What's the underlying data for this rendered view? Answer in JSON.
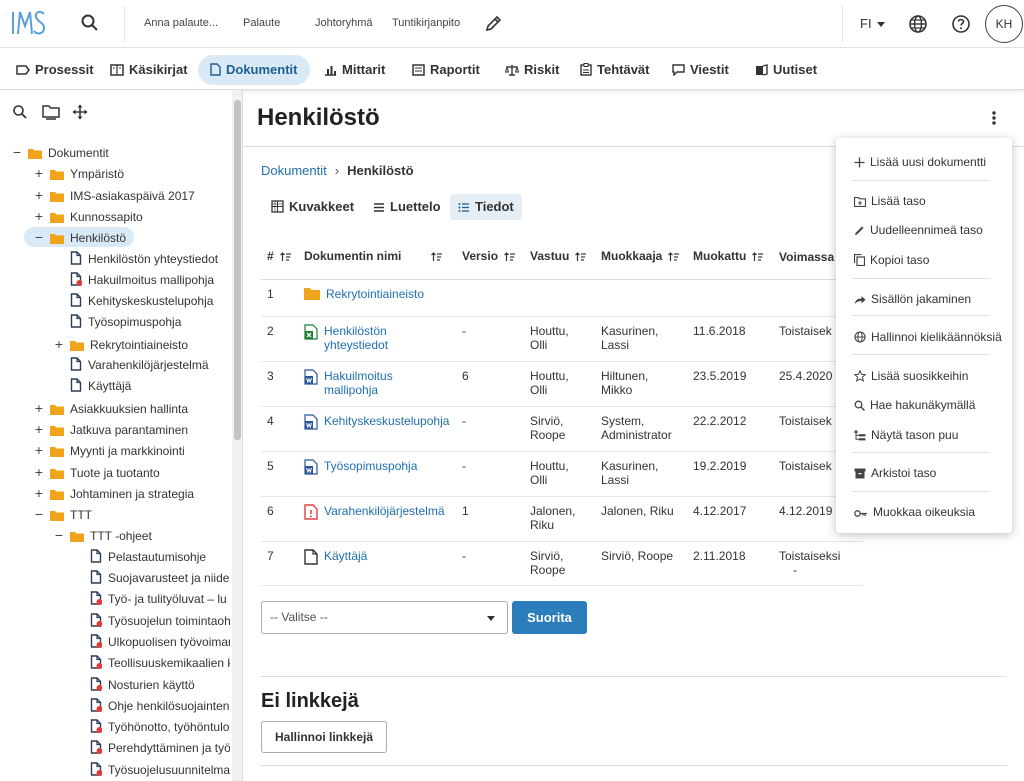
{
  "topbar": {
    "logo": "IMS",
    "quicklinks": [
      "Anna palaute...",
      "Palaute",
      "Johtoryhmä",
      "Tuntikirjanpito"
    ],
    "language": "FI",
    "avatar": "KH"
  },
  "nav": {
    "items": [
      {
        "label": "Prosessit",
        "icon": "process-icon"
      },
      {
        "label": "Käsikirjat",
        "icon": "manual-icon"
      },
      {
        "label": "Dokumentit",
        "icon": "document-icon"
      },
      {
        "label": "Mittarit",
        "icon": "chart-icon"
      },
      {
        "label": "Raportit",
        "icon": "report-icon"
      },
      {
        "label": "Riskit",
        "icon": "scale-icon"
      },
      {
        "label": "Tehtävät",
        "icon": "task-icon"
      },
      {
        "label": "Viestit",
        "icon": "message-icon"
      },
      {
        "label": "Uutiset",
        "icon": "news-icon"
      }
    ],
    "active": "Dokumentit"
  },
  "tree": [
    {
      "label": "Dokumentit",
      "toggle": "−",
      "type": "folder"
    },
    {
      "label": "Ympäristö",
      "toggle": "+",
      "type": "folder"
    },
    {
      "label": "IMS-asiakaspäivä 2017",
      "toggle": "+",
      "type": "folder"
    },
    {
      "label": "Kunnossapito",
      "toggle": "+",
      "type": "folder"
    },
    {
      "label": "Henkilöstö",
      "toggle": "−",
      "type": "folder",
      "selected": true
    },
    {
      "label": "Henkilöstön yhteystiedot",
      "toggle": "",
      "type": "doc"
    },
    {
      "label": "Hakuilmoitus mallipohja",
      "toggle": "",
      "type": "doc-alert"
    },
    {
      "label": "Kehityskeskustelupohja",
      "toggle": "",
      "type": "doc"
    },
    {
      "label": "Työsopimuspohja",
      "toggle": "",
      "type": "doc"
    },
    {
      "label": "Rekrytointiaineisto",
      "toggle": "+",
      "type": "folder"
    },
    {
      "label": "Varahenkilöjärjestelmä",
      "toggle": "",
      "type": "doc"
    },
    {
      "label": "Käyttäjä",
      "toggle": "",
      "type": "doc"
    },
    {
      "label": "Asiakkuuksien hallinta",
      "toggle": "+",
      "type": "folder"
    },
    {
      "label": "Jatkuva parantaminen",
      "toggle": "+",
      "type": "folder"
    },
    {
      "label": "Myynti ja markkinointi",
      "toggle": "+",
      "type": "folder"
    },
    {
      "label": "Tuote ja tuotanto",
      "toggle": "+",
      "type": "folder"
    },
    {
      "label": "Johtaminen ja strategia",
      "toggle": "+",
      "type": "folder"
    },
    {
      "label": "TTT",
      "toggle": "−",
      "type": "folder"
    },
    {
      "label": "TTT -ohjeet",
      "toggle": "−",
      "type": "folder"
    },
    {
      "label": "Pelastautumisohje",
      "toggle": "",
      "type": "doc"
    },
    {
      "label": "Suojavarusteet ja niiden",
      "toggle": "",
      "type": "doc"
    },
    {
      "label": "Työ- ja tulityöluvat – lu",
      "toggle": "",
      "type": "doc-alert"
    },
    {
      "label": "Työsuojelun toimintaoh",
      "toggle": "",
      "type": "doc-alert"
    },
    {
      "label": "Ulkopuolisen työvoiman",
      "toggle": "",
      "type": "doc-alert"
    },
    {
      "label": "Teollisuuskemikaalien k",
      "toggle": "",
      "type": "doc-alert"
    },
    {
      "label": "Nosturien käyttö",
      "toggle": "",
      "type": "doc-alert"
    },
    {
      "label": "Ohje henkilösuojainten",
      "toggle": "",
      "type": "doc-alert"
    },
    {
      "label": "Työhönotto, työhöntulo",
      "toggle": "",
      "type": "doc-alert"
    },
    {
      "label": "Perehdyttäminen ja työ",
      "toggle": "",
      "type": "doc-alert"
    },
    {
      "label": "Työsuojelusuunnitelma",
      "toggle": "",
      "type": "doc-alert"
    }
  ],
  "main": {
    "title": "Henkilöstö",
    "breadcrumb": {
      "root": "Dokumentit",
      "current": "Henkilöstö"
    },
    "views": [
      "Kuvakkeet",
      "Luettelo",
      "Tiedot"
    ],
    "active_view": "Tiedot",
    "columns": [
      "#",
      "Dokumentin nimi",
      "Versio",
      "Vastuu",
      "Muokkaaja",
      "Muokattu",
      "Voimassa"
    ],
    "rows": [
      {
        "n": "1",
        "name": "Rekrytointiaineisto",
        "ftype": "folder",
        "version": "",
        "owner": "",
        "editor": "",
        "modified": "",
        "valid": ""
      },
      {
        "n": "2",
        "name": "Henkilöstön yhteystiedot",
        "ftype": "excel",
        "version": "-",
        "owner": "Houttu, Olli",
        "editor": "Kasurinen, Lassi",
        "modified": "11.6.2018",
        "valid": "Toistaisek"
      },
      {
        "n": "3",
        "name": "Hakuilmoitus mallipohja",
        "ftype": "word",
        "version": "6",
        "owner": "Houttu, Olli",
        "editor": "Hiltunen, Mikko",
        "modified": "23.5.2019",
        "valid": "25.4.2020"
      },
      {
        "n": "4",
        "name": "Kehityskeskustelupohja",
        "ftype": "word",
        "version": "-",
        "owner": "Sirviö, Roope",
        "editor": "System, Administrator",
        "modified": "22.2.2012",
        "valid": "Toistaisek"
      },
      {
        "n": "5",
        "name": "Työsopimuspohja",
        "ftype": "word",
        "version": "-",
        "owner": "Houttu, Olli",
        "editor": "Kasurinen, Lassi",
        "modified": "19.2.2019",
        "valid": "Toistaisek"
      },
      {
        "n": "6",
        "name": "Varahenkilöjärjestelmä",
        "ftype": "pdf",
        "version": "1",
        "owner": "Jalonen, Riku",
        "editor": "Jalonen, Riku",
        "modified": "4.12.2017",
        "valid": "4.12.2019"
      },
      {
        "n": "7",
        "name": "Käyttäjä",
        "ftype": "blank",
        "version": "-",
        "owner": "Sirviö, Roope",
        "editor": "Sirviö, Roope",
        "modified": "2.11.2018",
        "valid": "Toistaiseksi"
      }
    ],
    "extra_cell": "-",
    "select_placeholder": "-- Valitse --",
    "run_button": "Suorita",
    "links_title": "Ei linkkejä",
    "links_button": "Hallinnoi linkkejä"
  },
  "menu": [
    {
      "label": "Lisää uusi dokumentti",
      "icon": "plus-icon"
    },
    {
      "label": "Lisää taso",
      "icon": "add-folder-icon"
    },
    {
      "label": "Uudelleennimeä taso",
      "icon": "pencil-icon"
    },
    {
      "label": "Kopioi taso",
      "icon": "copy-icon"
    },
    {
      "label": "Sisällön jakaminen",
      "icon": "share-icon"
    },
    {
      "label": "Hallinnoi kielikäännöksiä",
      "icon": "globe-icon"
    },
    {
      "label": "Lisää suosikkeihin",
      "icon": "star-icon"
    },
    {
      "label": "Hae hakunäkymällä",
      "icon": "search-icon"
    },
    {
      "label": "Näytä tason puu",
      "icon": "tree-icon"
    },
    {
      "label": "Arkistoi taso",
      "icon": "archive-icon"
    },
    {
      "label": "Muokkaa oikeuksia",
      "icon": "key-icon"
    }
  ],
  "colors": {
    "accent": "#2b7dbb",
    "active_bg": "#d9e9f6",
    "folder": "#f0a41c",
    "excel": "#1e7e34",
    "word": "#2a5699",
    "pdf": "#e04040",
    "alert_dot": "#e53935"
  }
}
